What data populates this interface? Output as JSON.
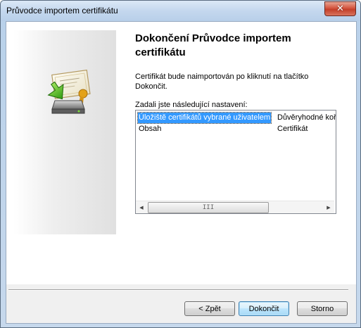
{
  "window": {
    "title": "Průvodce importem certifikátu",
    "close_glyph": "✕"
  },
  "wizard": {
    "heading": "Dokončení Průvodce importem certifikátu",
    "info_text": "Certifikát bude naimportován po kliknutí na tlačítko Dokončit.",
    "settings_label": "Zadali jste následující nastavení:",
    "graphic_icon": "certificate-import-icon"
  },
  "settings": {
    "rows": [
      {
        "name": "Úložiště certifikátů vybrané uživatelem",
        "value": "Důvěryhodné kořenové certifikační autority",
        "selected": true
      },
      {
        "name": "Obsah",
        "value": "Certifikát",
        "selected": false
      }
    ],
    "scroll_grip": "III",
    "scroll_left_glyph": "◀",
    "scroll_right_glyph": "▶"
  },
  "buttons": {
    "back": "< Zpět",
    "finish": "Dokončit",
    "cancel": "Storno"
  },
  "colors": {
    "selection": "#3399ff",
    "close_button": "#c33f2a",
    "default_button_border": "#3c7fb1"
  }
}
